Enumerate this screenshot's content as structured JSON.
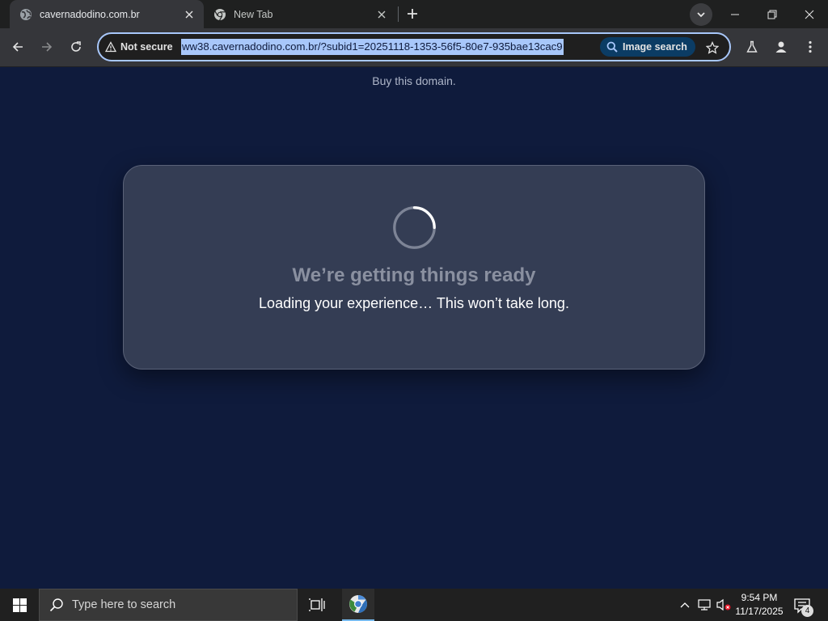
{
  "browser": {
    "tabs": [
      {
        "title": "cavernadodino.com.br",
        "active": true
      },
      {
        "title": "New Tab",
        "active": false
      }
    ],
    "address_bar": {
      "security_label": "Not secure",
      "url": "ww38.cavernadodino.com.br/?subid1=20251118-1353-56f5-80e7-935bae13cac9",
      "image_search_label": "Image search"
    }
  },
  "page": {
    "top_link": "Buy this domain.",
    "card": {
      "title": "We’re getting things ready",
      "subtitle": "Loading your experience… This won’t take long."
    }
  },
  "taskbar": {
    "search_placeholder": "Type here to search",
    "time": "9:54 PM",
    "date": "11/17/2025",
    "notification_count": "4"
  },
  "colors": {
    "page_background": "#0f1b3c",
    "card_background": "#343d54",
    "url_highlight": "#a8c7fa",
    "image_search_chip": "#0b3c64"
  }
}
